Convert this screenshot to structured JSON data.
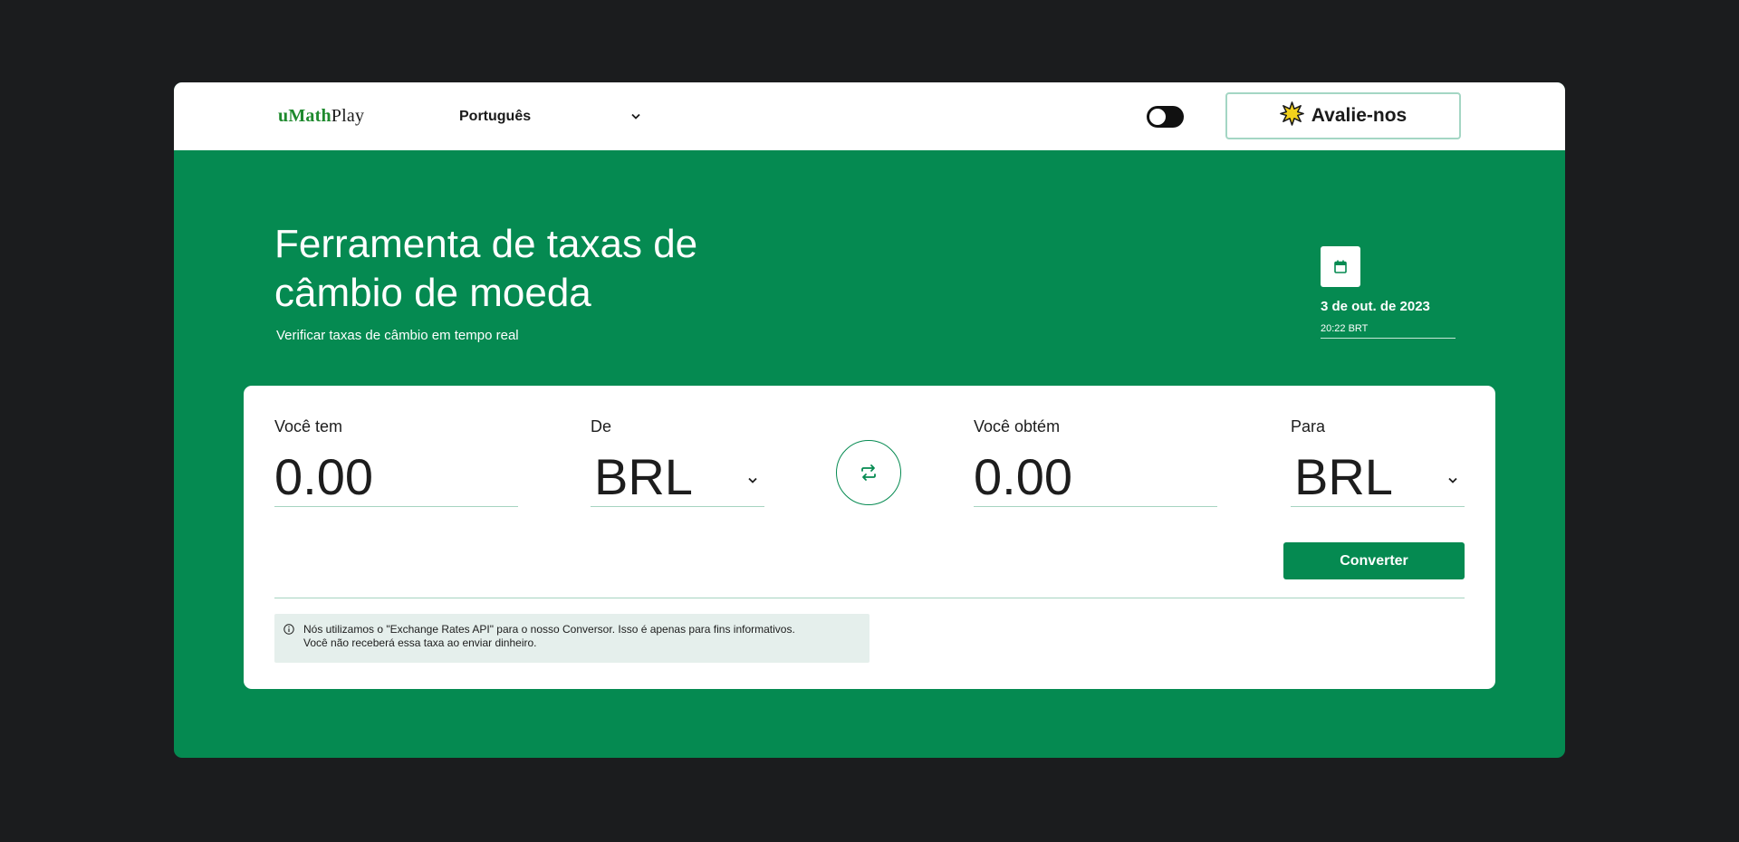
{
  "header": {
    "logo": {
      "part1": "uMath",
      "part2": "Play"
    },
    "language": {
      "selected": "Português"
    },
    "rate_button_label": "Avalie-nos"
  },
  "hero": {
    "title_line1": "Ferramenta de taxas de",
    "title_line2": "câmbio de moeda",
    "subtitle": "Verificar taxas de câmbio em tempo real",
    "date": "3 de out. de 2023",
    "time": "20:22 BRT"
  },
  "converter": {
    "have_label": "Você tem",
    "have_value": "0.00",
    "from_label": "De",
    "from_currency": "BRL",
    "get_label": "Você obtém",
    "get_value": "0.00",
    "to_label": "Para",
    "to_currency": "BRL",
    "convert_label": "Converter",
    "note_line1": "Nós utilizamos o \"Exchange Rates API\" para o nosso Conversor. Isso é apenas para fins informativos.",
    "note_line2": "Você não receberá essa taxa ao enviar dinheiro."
  },
  "icons": {
    "chevron": "chevron-down-icon",
    "calendar": "calendar-icon",
    "swap": "swap-icon",
    "info": "info-icon",
    "star": "star-badge-icon"
  },
  "colors": {
    "page_background": "#1b1c1e",
    "brand_green": "#058a51",
    "logo_green": "#1f8a2e",
    "accent_border": "#a4d6c4",
    "note_background": "#e5efec",
    "star_yellow": "#f4d21c"
  }
}
